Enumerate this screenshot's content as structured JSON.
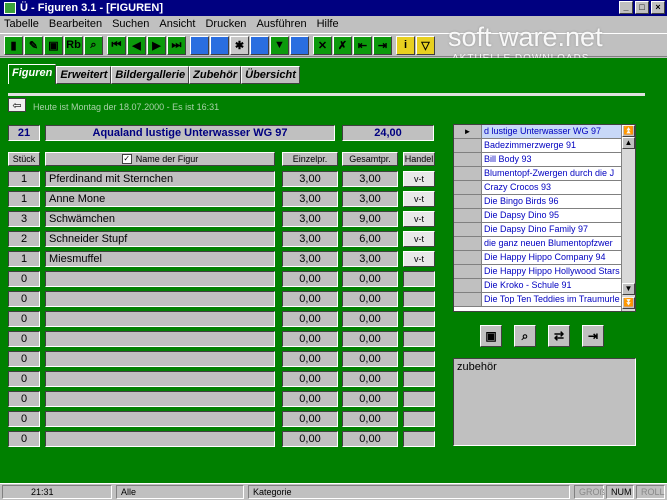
{
  "window": {
    "title": "Ü - Figuren 3.1 - [FIGUREN]",
    "buttons": [
      "_",
      "□",
      "×"
    ]
  },
  "menu": [
    "Tabelle",
    "Bearbeiten",
    "Suchen",
    "Ansicht",
    "Drucken",
    "Ausführen",
    "Hilfe"
  ],
  "toolbar": {
    "rb_label": "Rb",
    "info_label": "i"
  },
  "watermark": {
    "brand": "soft ware.net",
    "tagline": "AKTUELLE DOWNLOADS"
  },
  "tabs": [
    "Figuren",
    "Erweitert",
    "Bildergallerie",
    "Zubehör",
    "Übersicht"
  ],
  "date_line": "Heute ist Montag der 18.07.2000 - Es ist 16:31",
  "summary": {
    "count": "21",
    "set_name": "Aqualand lustige Unterwasser WG 97",
    "total": "24,00"
  },
  "columns": [
    "Stück",
    "Name der Figur",
    "Einzelpr.",
    "Gesamtpr.",
    "Handel"
  ],
  "rows": [
    {
      "qty": "1",
      "name": "Pferdinand mit Sternchen",
      "unit": "3,00",
      "total": "3,00",
      "handel": "v-t"
    },
    {
      "qty": "1",
      "name": "Anne Mone",
      "unit": "3,00",
      "total": "3,00",
      "handel": "v-t"
    },
    {
      "qty": "3",
      "name": "Schwämchen",
      "unit": "3,00",
      "total": "9,00",
      "handel": "v-t"
    },
    {
      "qty": "2",
      "name": "Schneider Stupf",
      "unit": "3,00",
      "total": "6,00",
      "handel": "v-t"
    },
    {
      "qty": "1",
      "name": "Miesmuffel",
      "unit": "3,00",
      "total": "3,00",
      "handel": "v-t"
    },
    {
      "qty": "0",
      "name": "",
      "unit": "0,00",
      "total": "0,00",
      "handel": ""
    },
    {
      "qty": "0",
      "name": "",
      "unit": "0,00",
      "total": "0,00",
      "handel": ""
    },
    {
      "qty": "0",
      "name": "",
      "unit": "0,00",
      "total": "0,00",
      "handel": ""
    },
    {
      "qty": "0",
      "name": "",
      "unit": "0,00",
      "total": "0,00",
      "handel": ""
    },
    {
      "qty": "0",
      "name": "",
      "unit": "0,00",
      "total": "0,00",
      "handel": ""
    },
    {
      "qty": "0",
      "name": "",
      "unit": "0,00",
      "total": "0,00",
      "handel": ""
    },
    {
      "qty": "0",
      "name": "",
      "unit": "0,00",
      "total": "0,00",
      "handel": ""
    },
    {
      "qty": "0",
      "name": "",
      "unit": "0,00",
      "total": "0,00",
      "handel": ""
    },
    {
      "qty": "0",
      "name": "",
      "unit": "0,00",
      "total": "0,00",
      "handel": ""
    }
  ],
  "set_list": {
    "selected_marker": "►",
    "items": [
      "d lustige Unterwasser WG 97",
      "Badezimmerzwerge 91",
      "Bill Body 93",
      "Blumentopf-Zwergen durch die J",
      "Crazy Crocos 93",
      "Die Bingo Birds 96",
      "Die Dapsy Dino 95",
      "Die Dapsy Dino Family 97",
      "die ganz neuen Blumentopfzwer",
      "Die Happy Hippo Company 94",
      "Die Happy Hippo Hollywood Stars",
      "Die Kroko - Schule 91",
      "Die Top Ten Teddies im Traumurle"
    ]
  },
  "notes": "zubehör",
  "status": {
    "time": "21:31",
    "filter": "Alle",
    "field": "Kategorie",
    "gross": "GROß",
    "num": "NUM",
    "roll": "ROLL"
  },
  "colors": {
    "background": "#008000",
    "titlebar": "#000080",
    "panel": "#c0c0c0",
    "list_text": "#0000c0"
  }
}
